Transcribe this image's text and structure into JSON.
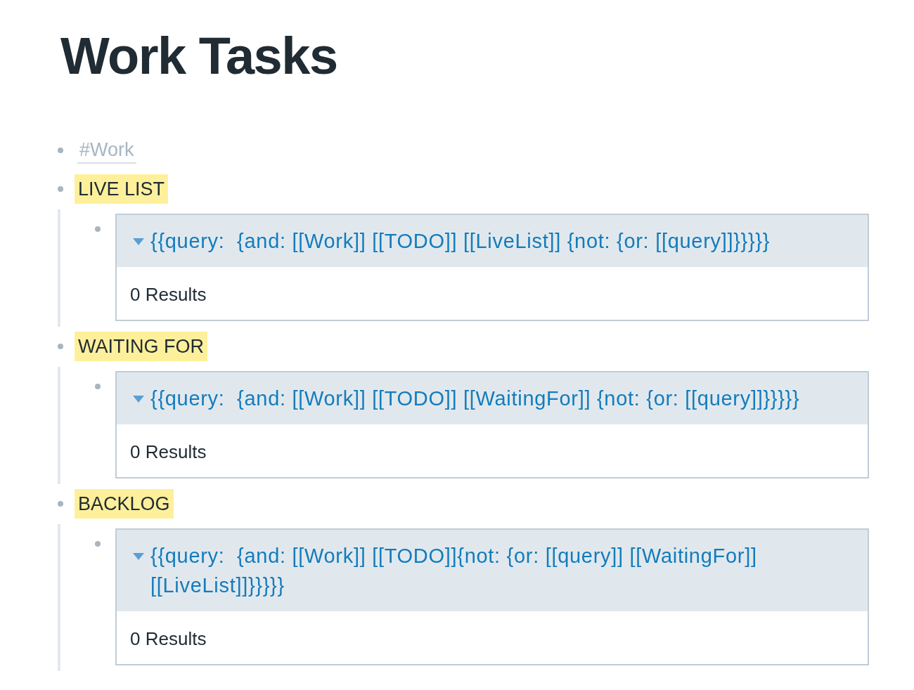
{
  "page": {
    "title": "Work Tasks"
  },
  "blocks": [
    {
      "kind": "tag",
      "text": "#Work"
    },
    {
      "kind": "highlight",
      "text": "LIVE LIST",
      "children": [
        {
          "kind": "query",
          "expanded": true,
          "query": "{{query:  {and: [[Work]] [[TODO]] [[LiveList]] {not: {or: [[query]]}}}}}",
          "results": "0 Results"
        }
      ]
    },
    {
      "kind": "highlight",
      "text": "WAITING FOR",
      "children": [
        {
          "kind": "query",
          "expanded": true,
          "query": "{{query:  {and: [[Work]] [[TODO]] [[WaitingFor]] {not: {or: [[query]]}}}}}",
          "results": "0 Results"
        }
      ]
    },
    {
      "kind": "highlight",
      "text": "BACKLOG",
      "children": [
        {
          "kind": "query",
          "expanded": true,
          "query": "{{query:  {and: [[Work]] [[TODO]]{not: {or: [[query]] [[WaitingFor]] [[LiveList]]}}}}}",
          "results": "0 Results"
        }
      ]
    }
  ]
}
